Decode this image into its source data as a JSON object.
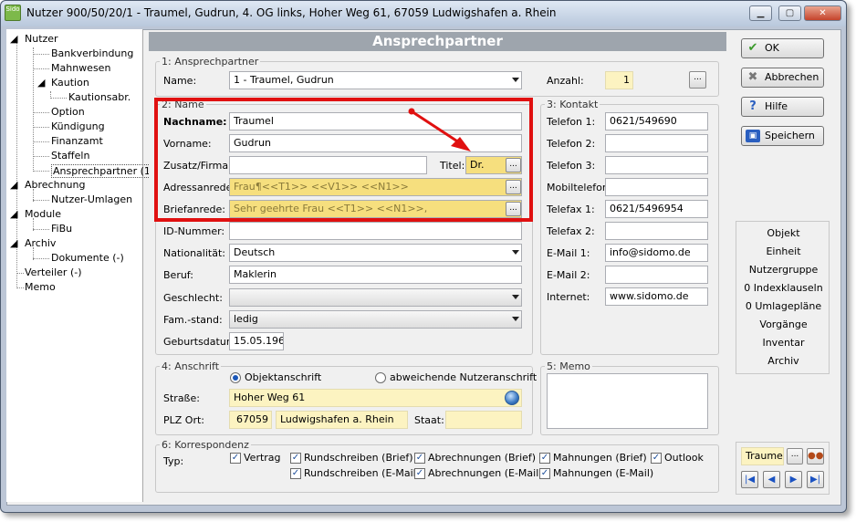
{
  "window": {
    "title": "Nutzer 900/50/20/1 - Traumel, Gudrun, 4. OG links, Hoher Weg 61, 67059 Ludwigshafen a. Rhein",
    "icon_text": "Sido"
  },
  "tree": {
    "items": [
      {
        "label": "Nutzer"
      },
      {
        "label": "Bankverbindung"
      },
      {
        "label": "Mahnwesen"
      },
      {
        "label": "Kaution"
      },
      {
        "label": "Kautionsabr."
      },
      {
        "label": "Option"
      },
      {
        "label": "Kündigung"
      },
      {
        "label": "Finanzamt"
      },
      {
        "label": "Staffeln"
      },
      {
        "label": "Ansprechpartner (1)"
      },
      {
        "label": "Abrechnung"
      },
      {
        "label": "Nutzer-Umlagen"
      },
      {
        "label": "Module"
      },
      {
        "label": "FiBu"
      },
      {
        "label": "Archiv"
      },
      {
        "label": "Dokumente (-)"
      },
      {
        "label": "Verteiler (-)"
      },
      {
        "label": "Memo"
      }
    ]
  },
  "header": {
    "title": "Ansprechpartner"
  },
  "section1": {
    "legend": "1: Ansprechpartner",
    "name_label": "Name:",
    "name_value": "1 - Traumel, Gudrun",
    "anzahl_label": "Anzahl:",
    "anzahl_value": "1"
  },
  "section2": {
    "legend": "2: Name",
    "nachname_label": "Nachname:",
    "nachname_value": "Traumel",
    "vorname_label": "Vorname:",
    "vorname_value": "Gudrun",
    "zusatz_label": "Zusatz/Firma:",
    "zusatz_value": "",
    "titel_label": "Titel:",
    "titel_value": "Dr.",
    "adressanrede_label": "Adressanrede:",
    "adressanrede_value": "Frau¶<<T1>> <<V1>> <<N1>>",
    "briefanrede_label": "Briefanrede:",
    "briefanrede_value": "Sehr geehrte Frau <<T1>> <<N1>>,",
    "id_label": "ID-Nummer:",
    "id_value": "",
    "nationalitaet_label": "Nationalität:",
    "nationalitaet_value": "Deutsch",
    "beruf_label": "Beruf:",
    "beruf_value": "Maklerin",
    "geschlecht_label": "Geschlecht:",
    "geschlecht_value": "",
    "famstand_label": "Fam.-stand:",
    "famstand_value": "ledig",
    "geburtsdatum_label": "Geburtsdatum:",
    "geburtsdatum_value": "15.05.1965"
  },
  "section3": {
    "legend": "3: Kontakt",
    "rows": [
      {
        "label": "Telefon 1:",
        "value": "0621/549690"
      },
      {
        "label": "Telefon 2:",
        "value": ""
      },
      {
        "label": "Telefon 3:",
        "value": ""
      },
      {
        "label": "Mobiltelefon:",
        "value": ""
      },
      {
        "label": "Telefax 1:",
        "value": "0621/5496954"
      },
      {
        "label": "Telefax 2:",
        "value": ""
      },
      {
        "label": "E-Mail 1:",
        "value": "info@sidomo.de"
      },
      {
        "label": "E-Mail 2:",
        "value": ""
      },
      {
        "label": "Internet:",
        "value": "www.sidomo.de"
      }
    ]
  },
  "section4": {
    "legend": "4: Anschrift",
    "radio1": "Objektanschrift",
    "radio2": "abweichende Nutzeranschrift",
    "strasse_label": "Straße:",
    "strasse_value": "Hoher Weg 61",
    "plzort_label": "PLZ Ort:",
    "plz_value": "67059",
    "ort_value": "Ludwigshafen a. Rhein",
    "staat_label": "Staat:",
    "staat_value": ""
  },
  "section5": {
    "legend": "5: Memo"
  },
  "section6": {
    "legend": "6: Korrespondenz",
    "typ_label": "Typ:",
    "checkboxes": [
      {
        "label": "Vertrag"
      },
      {
        "label": "Rundschreiben (Brief)"
      },
      {
        "label": "Abrechnungen (Brief)"
      },
      {
        "label": "Mahnungen (Brief)"
      },
      {
        "label": "Outlook"
      },
      {
        "label": "Rundschreiben (E-Mail)"
      },
      {
        "label": "Abrechnungen (E-Mail)"
      },
      {
        "label": "Mahnungen (E-Mail)"
      }
    ]
  },
  "buttons": {
    "ok": "OK",
    "abbrechen": "Abbrechen",
    "hilfe": "Hilfe",
    "speichern": "Speichern"
  },
  "side_list": [
    "Objekt",
    "Einheit",
    "Nutzergruppe",
    "0 Indexklauseln",
    "0 Umlagepläne",
    "Vorgänge",
    "Inventar",
    "Archiv"
  ],
  "record_nav": {
    "current": "Traumel,"
  },
  "icons": {
    "ok": "check-icon",
    "abbrechen": "x-icon",
    "hilfe": "help-icon",
    "speichern": "save-disk-icon",
    "globe": "globe-icon",
    "people": "people-icon"
  },
  "colors": {
    "header_bg": "#9ea5ad",
    "highlight_red": "#e01010",
    "yellow_field": "#fcf3c1",
    "yellow_strong": "#f6df7e"
  },
  "ellipsis": "..."
}
